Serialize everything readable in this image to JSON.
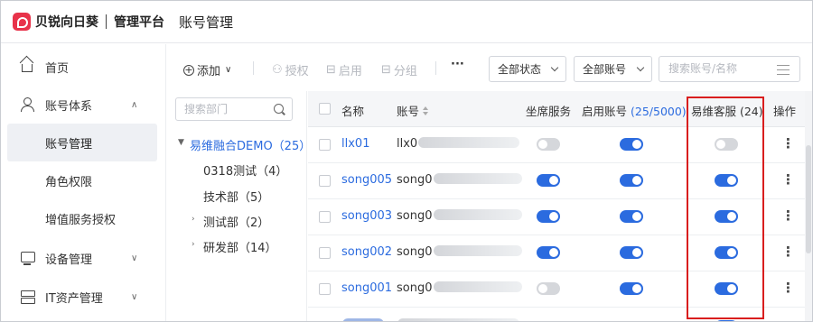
{
  "header": {
    "brand": "贝锐向日葵",
    "admin": "管理平台",
    "page_title": "账号管理"
  },
  "sidebar": {
    "items": [
      {
        "label": "首页",
        "icon": "home-icon"
      },
      {
        "label": "账号体系",
        "icon": "user-icon",
        "expanded": true
      },
      {
        "label": "账号管理",
        "active": true
      },
      {
        "label": "角色权限"
      },
      {
        "label": "增值服务授权"
      },
      {
        "label": "设备管理",
        "icon": "monitor-icon"
      },
      {
        "label": "IT资产管理",
        "icon": "server-icon"
      }
    ]
  },
  "toolbar": {
    "add": "添加",
    "authorize": "授权",
    "enable": "启用",
    "group": "分组",
    "more": "···",
    "status_filter": "全部状态",
    "account_filter": "全部账号",
    "search_placeholder": "搜索账号/名称"
  },
  "tree": {
    "search_placeholder": "搜索部门",
    "root": "易维融合DEMO（25）",
    "children": [
      {
        "label": "0318测试（4）"
      },
      {
        "label": "技术部（5）"
      },
      {
        "label": "测试部（2）"
      },
      {
        "label": "研发部（14）"
      }
    ]
  },
  "table": {
    "headers": {
      "name": "名称",
      "account": "账号",
      "seat": "坐席服务",
      "enabled": "启用账号",
      "enabled_count": "(25/5000)",
      "yiwei": "易维客服 (24)",
      "ops": "操作"
    },
    "rows": [
      {
        "name": "llx01",
        "account": "llx0",
        "seat": false,
        "enabled": true,
        "yiwei": false
      },
      {
        "name": "song005",
        "account": "song0",
        "seat": true,
        "enabled": true,
        "yiwei": true
      },
      {
        "name": "song003",
        "account": "song0",
        "seat": true,
        "enabled": true,
        "yiwei": true
      },
      {
        "name": "song002",
        "account": "song0",
        "seat": true,
        "enabled": true,
        "yiwei": true
      },
      {
        "name": "song001",
        "account": "song0",
        "seat": false,
        "enabled": true,
        "yiwei": true
      }
    ]
  },
  "colors": {
    "accent": "#2b6bdf",
    "highlight": "#d91e1e",
    "brand": "#e8334a"
  }
}
